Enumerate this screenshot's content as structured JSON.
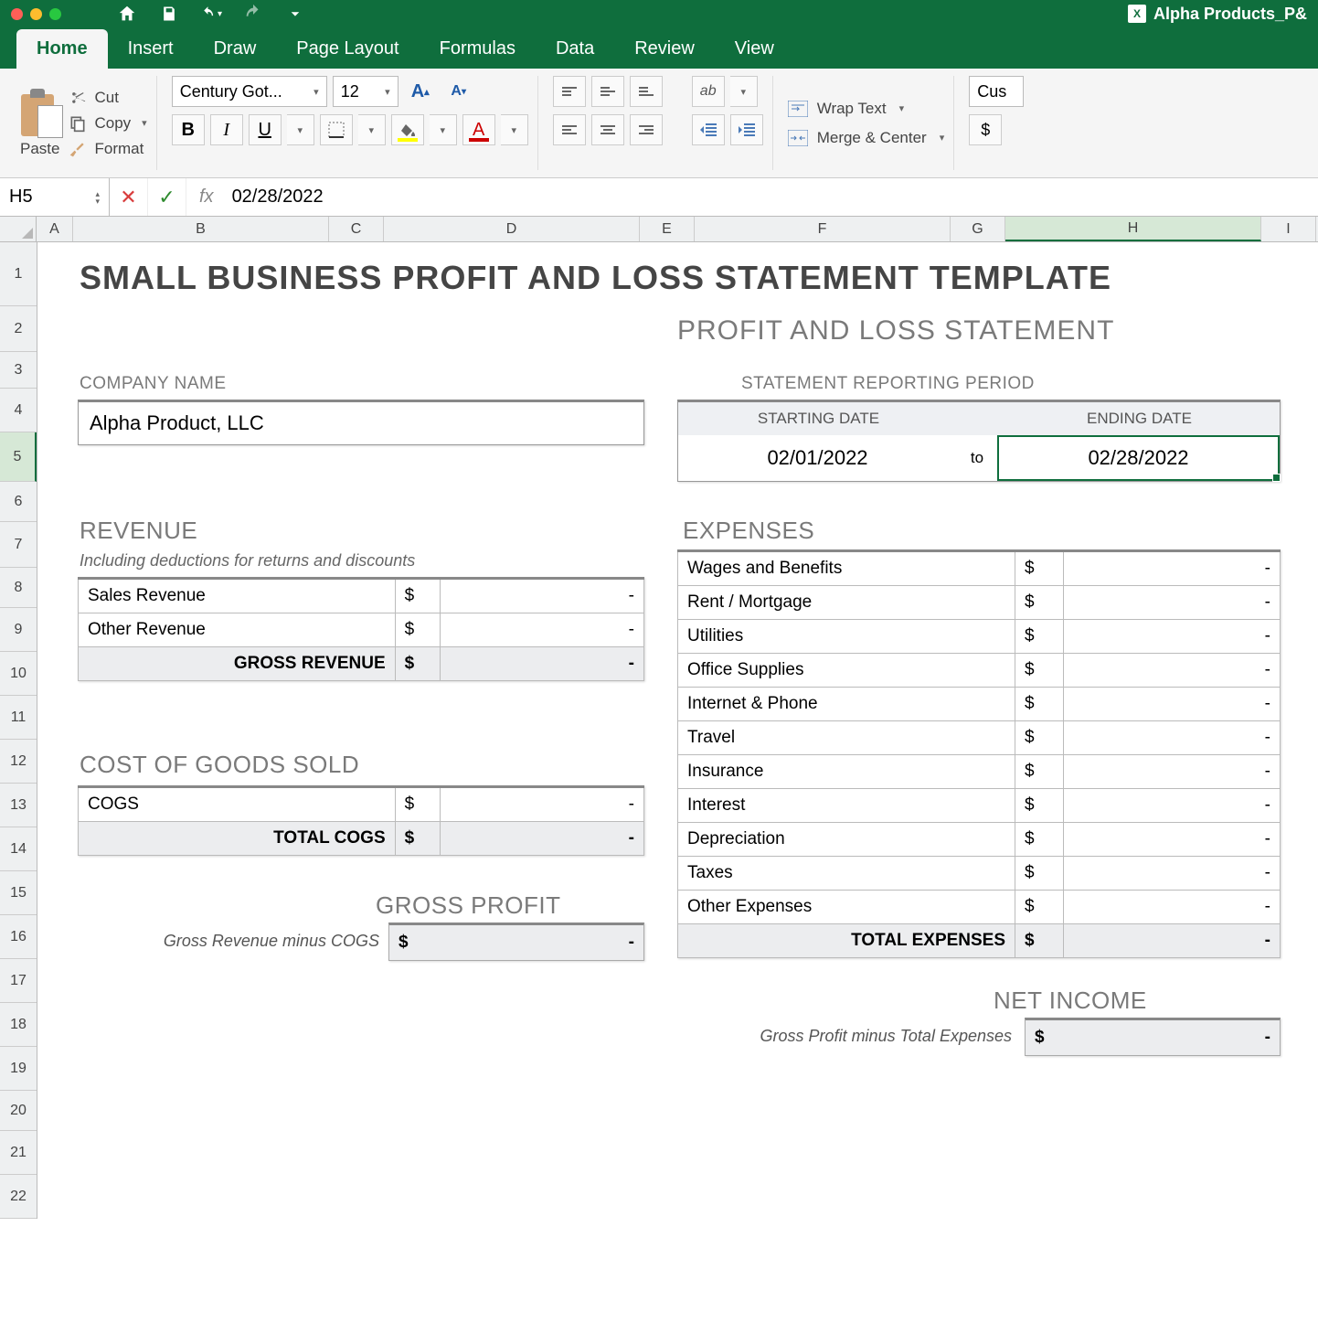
{
  "titlebar": {
    "document": "Alpha Products_P&"
  },
  "tabs": [
    "Home",
    "Insert",
    "Draw",
    "Page Layout",
    "Formulas",
    "Data",
    "Review",
    "View"
  ],
  "ribbon": {
    "paste": "Paste",
    "cut": "Cut",
    "copy": "Copy",
    "format": "Format",
    "font_name": "Century Got...",
    "font_size": "12",
    "wrap": "Wrap Text",
    "merge": "Merge & Center",
    "number_fmt": "Cus",
    "currency": "$"
  },
  "formula_bar": {
    "cell_ref": "H5",
    "fx": "fx",
    "value": "02/28/2022"
  },
  "columns": [
    "A",
    "B",
    "C",
    "D",
    "E",
    "F",
    "G",
    "H",
    "I"
  ],
  "row_count": 22,
  "sheet": {
    "title": "SMALL BUSINESS PROFIT AND LOSS STATEMENT TEMPLATE",
    "subtitle": "PROFIT AND LOSS STATEMENT",
    "company_label": "COMPANY NAME",
    "company_name": "Alpha Product, LLC",
    "period_label": "STATEMENT REPORTING PERIOD",
    "start_label": "STARTING DATE",
    "end_label": "ENDING DATE",
    "start_date": "02/01/2022",
    "to": "to",
    "end_date": "02/28/2022",
    "revenue_head": "REVENUE",
    "revenue_sub": "Including deductions for returns and discounts",
    "revenue_rows": [
      {
        "label": "Sales Revenue",
        "cur": "$",
        "val": "-"
      },
      {
        "label": "Other Revenue",
        "cur": "$",
        "val": "-"
      }
    ],
    "gross_rev_label": "GROSS REVENUE",
    "gross_rev_cur": "$",
    "gross_rev_val": "-",
    "cogs_head": "COST OF GOODS SOLD",
    "cogs_rows": [
      {
        "label": "COGS",
        "cur": "$",
        "val": "-"
      }
    ],
    "total_cogs_label": "TOTAL COGS",
    "total_cogs_cur": "$",
    "total_cogs_val": "-",
    "gp_head": "GROSS PROFIT",
    "gp_sub": "Gross Revenue minus COGS",
    "gp_cur": "$",
    "gp_val": "-",
    "exp_head": "EXPENSES",
    "exp_rows": [
      {
        "label": "Wages and Benefits",
        "cur": "$",
        "val": "-"
      },
      {
        "label": "Rent / Mortgage",
        "cur": "$",
        "val": "-"
      },
      {
        "label": "Utilities",
        "cur": "$",
        "val": "-"
      },
      {
        "label": "Office Supplies",
        "cur": "$",
        "val": "-"
      },
      {
        "label": "Internet & Phone",
        "cur": "$",
        "val": "-"
      },
      {
        "label": "Travel",
        "cur": "$",
        "val": "-"
      },
      {
        "label": "Insurance",
        "cur": "$",
        "val": "-"
      },
      {
        "label": "Interest",
        "cur": "$",
        "val": "-"
      },
      {
        "label": "Depreciation",
        "cur": "$",
        "val": "-"
      },
      {
        "label": "Taxes",
        "cur": "$",
        "val": "-"
      },
      {
        "label": "Other Expenses",
        "cur": "$",
        "val": "-"
      }
    ],
    "total_exp_label": "TOTAL EXPENSES",
    "total_exp_cur": "$",
    "total_exp_val": "-",
    "ni_head": "NET INCOME",
    "ni_sub": "Gross Profit minus Total Expenses",
    "ni_cur": "$",
    "ni_val": "-"
  }
}
